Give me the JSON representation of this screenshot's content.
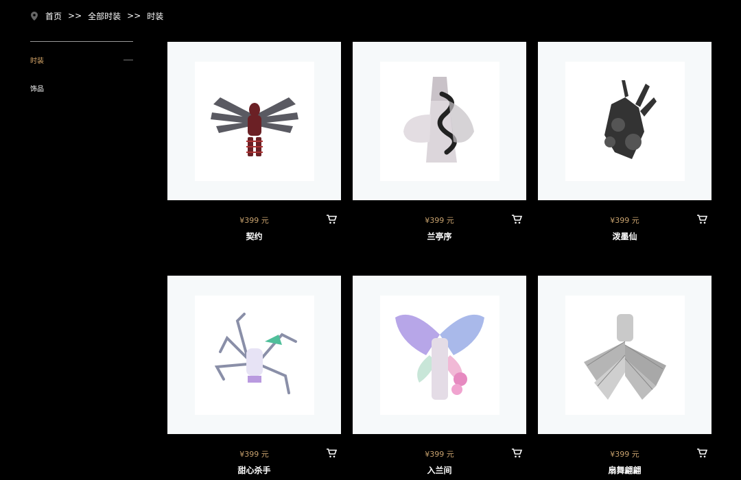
{
  "breadcrumb": {
    "home": "首页",
    "sep1": ">>",
    "all": "全部时装",
    "sep2": ">>",
    "current": "时装"
  },
  "sidebar": {
    "items": [
      {
        "label": "时装",
        "active": true
      },
      {
        "label": "饰品",
        "active": false
      }
    ]
  },
  "products": [
    {
      "price": "¥399 元",
      "name": "契约",
      "icon": "winged-armor-figure"
    },
    {
      "price": "¥399 元",
      "name": "兰亭序",
      "icon": "dress-with-dragon"
    },
    {
      "price": "¥399 元",
      "name": "泼墨仙",
      "icon": "ink-splash-dress"
    },
    {
      "price": "¥399 元",
      "name": "甜心杀手",
      "icon": "spider-mech-outfit"
    },
    {
      "price": "¥399 元",
      "name": "入兰间",
      "icon": "butterfly-wing-dress"
    },
    {
      "price": "¥399 元",
      "name": "扇舞翩翩",
      "icon": "fan-ruffle-dress"
    }
  ],
  "colors": {
    "accent": "#d9a86a",
    "price": "#c8a26e",
    "background": "#000000"
  }
}
